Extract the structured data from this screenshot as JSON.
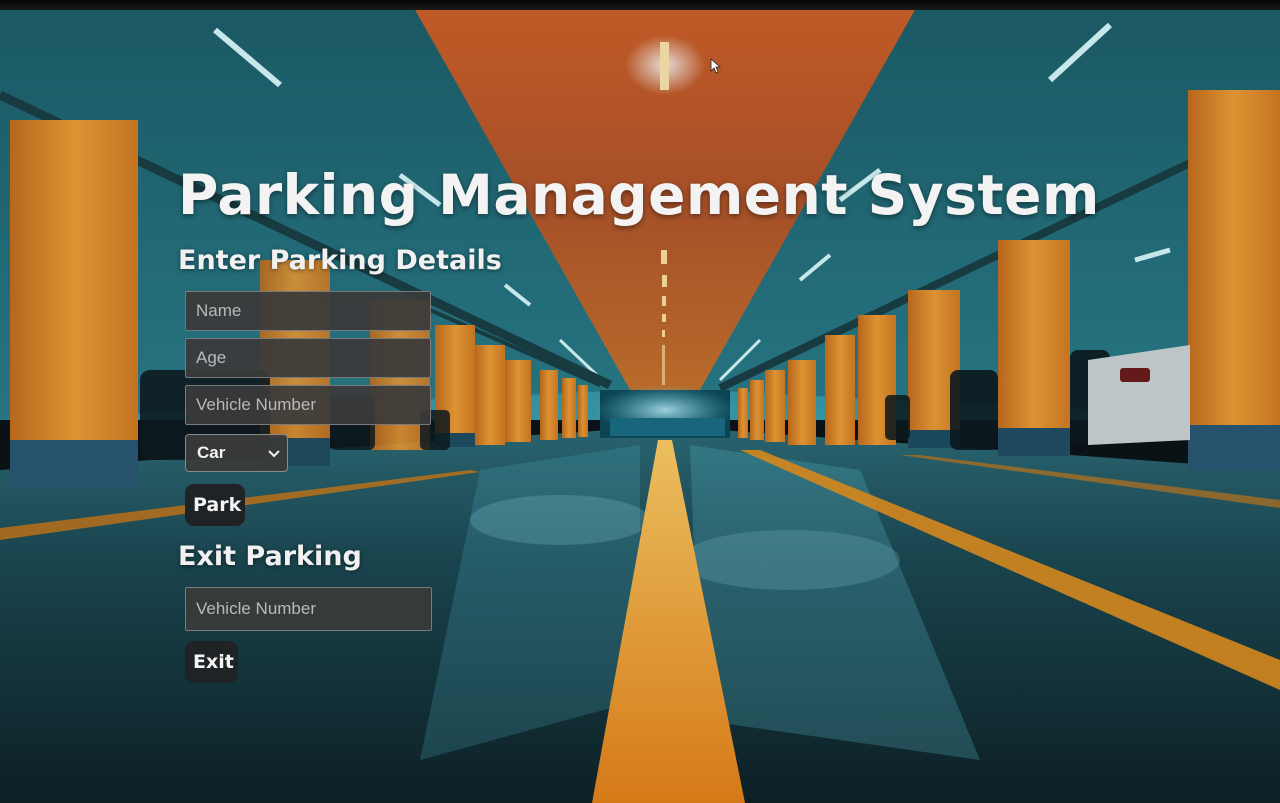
{
  "page": {
    "title": "Parking Management System"
  },
  "entry_form": {
    "heading": "Enter Parking Details",
    "name_placeholder": "Name",
    "age_placeholder": "Age",
    "vehicle_number_placeholder": "Vehicle Number",
    "vehicle_type_selected": "Car",
    "park_button_label": "Park"
  },
  "exit_form": {
    "heading": "Exit Parking",
    "vehicle_number_placeholder": "Vehicle Number",
    "exit_button_label": "Exit"
  },
  "icons": {
    "select": "chevron-down-icon",
    "pointer": "mouse-cursor-icon"
  },
  "colors": {
    "pillar_orange": "#e98f2a",
    "ceiling_teal": "#2c8596",
    "floor_dark": "#123038",
    "center_line": "#f29a1f",
    "field_background": "#3a3a3a",
    "button_background": "#1f2326",
    "title_text": "#f3f3f3"
  }
}
